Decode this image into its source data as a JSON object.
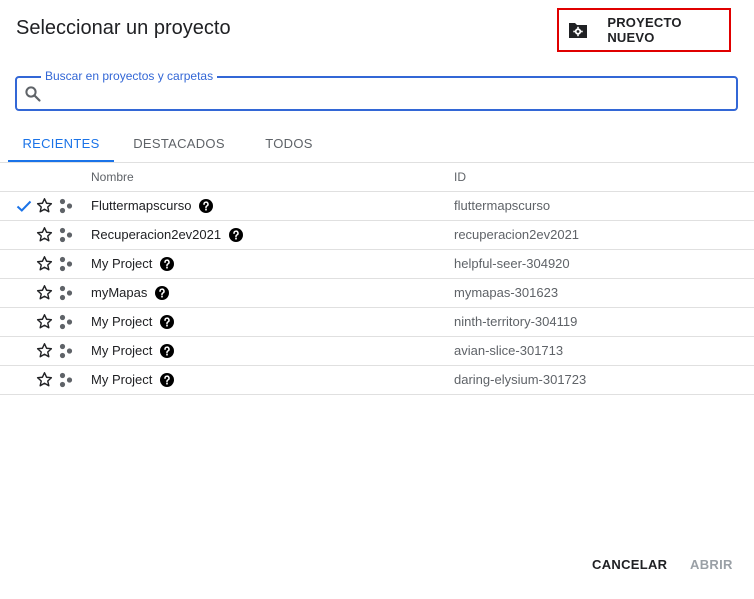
{
  "dialog": {
    "title": "Seleccionar un proyecto",
    "new_project_label": "PROYECTO NUEVO"
  },
  "search": {
    "label": "Buscar en proyectos y carpetas",
    "value": "",
    "placeholder": ""
  },
  "tabs": [
    {
      "label": "RECIENTES",
      "active": true
    },
    {
      "label": "DESTACADOS",
      "active": false
    },
    {
      "label": "TODOS",
      "active": false
    }
  ],
  "table": {
    "columns": {
      "name": "Nombre",
      "id": "ID"
    },
    "rows": [
      {
        "name": "Fluttermapscurso",
        "id": "fluttermapscurso",
        "selected": true
      },
      {
        "name": "Recuperacion2ev2021",
        "id": "recuperacion2ev2021",
        "selected": false
      },
      {
        "name": "My Project",
        "id": "helpful-seer-304920",
        "selected": false
      },
      {
        "name": "myMapas",
        "id": "mymapas-301623",
        "selected": false
      },
      {
        "name": "My Project",
        "id": "ninth-territory-304119",
        "selected": false
      },
      {
        "name": "My Project",
        "id": "avian-slice-301713",
        "selected": false
      },
      {
        "name": "My Project",
        "id": "daring-elysium-301723",
        "selected": false
      }
    ]
  },
  "footer": {
    "cancel_label": "CANCELAR",
    "open_label": "ABRIR"
  },
  "colors": {
    "accent": "#1a73e8",
    "highlight_border": "#e00000",
    "disabled": "#9aa0a6"
  },
  "icons": {
    "new_project": "folder-gear-icon",
    "search": "search-icon",
    "selected": "check-icon",
    "star": "star-outline-icon",
    "project": "project-dots-icon",
    "help": "help-circle-icon"
  }
}
